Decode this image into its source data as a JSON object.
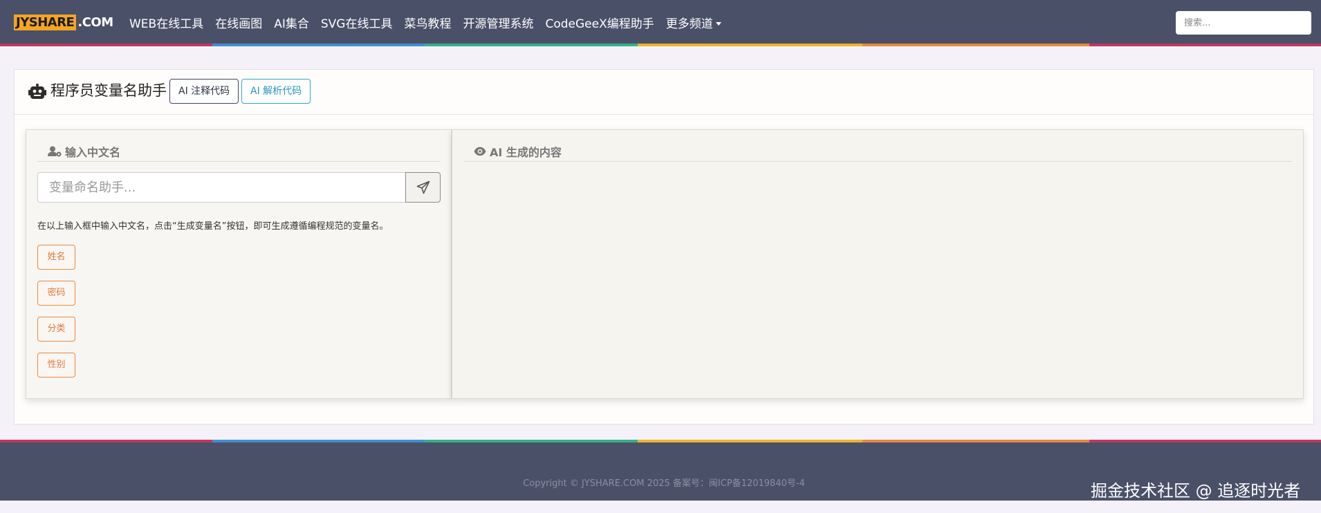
{
  "colors": {
    "navbar_bg": "#4b5069",
    "accent_orange": "#e8893b",
    "logo_yellow": "#f4a522",
    "rainbow": [
      "#c2375e",
      "#3f8fd0",
      "#34b08a",
      "#f0b429",
      "#e8893b",
      "#c2375e"
    ]
  },
  "navbar": {
    "logo_part1": "JYSHARE",
    "logo_part2": ".COM",
    "links": [
      {
        "label": "WEB在线工具"
      },
      {
        "label": "在线画图"
      },
      {
        "label": "AI集合"
      },
      {
        "label": "SVG在线工具"
      },
      {
        "label": "菜鸟教程"
      },
      {
        "label": "开源管理系统"
      },
      {
        "label": "CodeGeeX编程助手"
      },
      {
        "label": "更多频道",
        "dropdown": true
      }
    ],
    "search_placeholder": "搜索..."
  },
  "card": {
    "icon": "robot-icon",
    "title": "程序员变量名助手",
    "buttons": [
      {
        "label": "AI 注释代码",
        "color": "#3c4660"
      },
      {
        "label": "AI 解析代码",
        "color": "#31a3c9"
      }
    ]
  },
  "input_panel": {
    "icon": "user-gear-icon",
    "title": "输入中文名",
    "input_value": "",
    "input_placeholder": "变量命名助手...",
    "send_icon": "paper-plane-icon",
    "hint": "在以上输入框中输入中文名，点击“生成变量名”按钮，即可生成遵循编程规范的变量名。",
    "examples": [
      {
        "label": "姓名"
      },
      {
        "label": "密码"
      },
      {
        "label": "分类"
      },
      {
        "label": "性别"
      }
    ]
  },
  "output_panel": {
    "icon": "eye-icon",
    "title": "AI 生成的内容"
  },
  "footer": {
    "copyright": "Copyright © JYSHARE.COM 2025 备案号：闽ICP备12019840号-4",
    "watermark": "掘金技术社区 @ 追逐时光者"
  }
}
